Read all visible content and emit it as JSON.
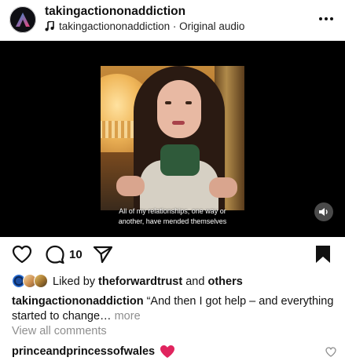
{
  "post": {
    "username": "takingactiononaddiction",
    "audio": "takingactiononaddiction · Original audio"
  },
  "media": {
    "caption_line1": "All of my relationships, one way or",
    "caption_line2": "another, have mended themselves"
  },
  "actions": {
    "comment_count": "10"
  },
  "likes": {
    "prefix": "Liked by",
    "user": "theforwardtrust",
    "and": "and",
    "others": "others"
  },
  "caption": {
    "username": "takingactiononaddiction",
    "text": "“And then I got help – and everything started to change…",
    "more": "more"
  },
  "comments": {
    "view_all": "View all comments",
    "first_user": "princeandprincessofwales"
  },
  "colors": {
    "accent_heart": "#e0245e",
    "muted": "#8e8e8e",
    "logo_blue": "#2b8fd6",
    "logo_pink": "#e8457c"
  },
  "icons": [
    "avatar-logo-icon",
    "music-note-icon",
    "more-dots-icon",
    "sound-icon",
    "heart-icon",
    "comment-icon",
    "share-icon",
    "bookmark-icon",
    "small-heart-icon"
  ]
}
